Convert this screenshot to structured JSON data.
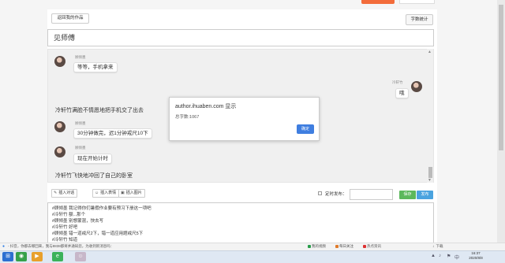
{
  "header": {
    "back_button": "返回我的作品",
    "word_stats_button": "字数统计",
    "title": "见师傅"
  },
  "dialogue": {
    "messages": [
      {
        "type": "bubble",
        "side": "left",
        "name": "顾倾墨",
        "text": "等等，手机拿来"
      },
      {
        "type": "bubble",
        "side": "right",
        "name": "冷轩竹",
        "text": "哦"
      },
      {
        "type": "narration",
        "text": "冷轩竹满脸不情愿地把手机交了出去"
      },
      {
        "type": "bubble",
        "side": "left",
        "name": "顾倾墨",
        "text": "30分钟做完，迟1分钟戒尺10下"
      },
      {
        "type": "bubble",
        "side": "left",
        "name": "顾倾墨",
        "text": "现在开始计时"
      },
      {
        "type": "narration",
        "text": "冷轩竹飞快地冲回了自己的卧室"
      }
    ]
  },
  "alert": {
    "title": "author.ihuaben.com 显示",
    "message": "总字数:1067",
    "ok_button": "确定"
  },
  "toolbar": {
    "insert_dialogue": "插入对话",
    "insert_emoji": "插入表情",
    "insert_image": "插入图片",
    "timed_publish_label": "定时发布：",
    "save_button": "保存",
    "publish_button": "发布"
  },
  "editor": {
    "lines": [
      "#顾倾墨 我记得你们暑假作业要有预习下册这一项吧",
      "#冷轩竹 额...那个",
      "#顾倾墨 别想蒙混，快去写",
      "#冷轩竹 好吧",
      "#顾倾墨 错一道戒尺2下，错一道应用题戒尺5下",
      "#冷轩竹 知道"
    ]
  },
  "statusbar": {
    "notice": "- 抖音，你都去哪回来，我与8838都将并通知您，为收到新消息吗：",
    "items": [
      "我的视频",
      "每日关注",
      "热点资讯"
    ],
    "download": "下载"
  },
  "taskbar": {
    "time": "16:37",
    "date": "2020/8/8"
  },
  "colors": {
    "accent_blue": "#3f7ee0",
    "save_green": "#5cb85c",
    "publish_blue": "#4aa3df",
    "top_orange": "#f36c3b"
  }
}
